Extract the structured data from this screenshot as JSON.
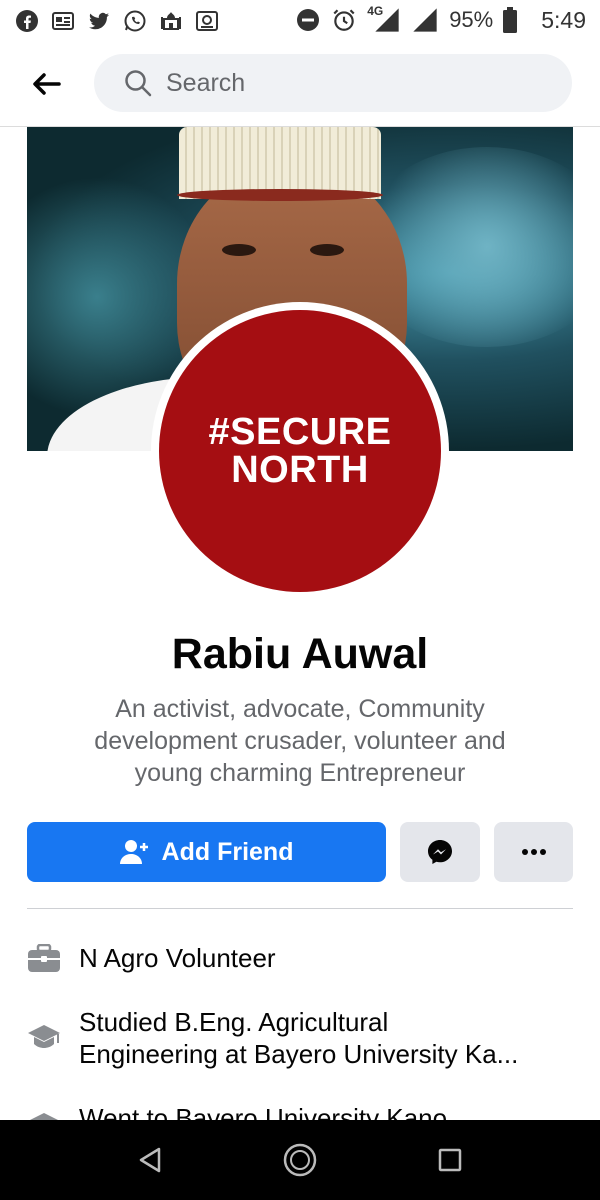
{
  "status_bar": {
    "network": "4G",
    "battery": "95%",
    "time": "5:49"
  },
  "search": {
    "placeholder": "Search"
  },
  "profile_picture": {
    "line1": "#SECURE",
    "line2": "NORTH"
  },
  "profile": {
    "name": "Rabiu Auwal",
    "bio": "An activist, advocate, Community development crusader, volunteer and young charming Entrepreneur"
  },
  "actions": {
    "add_friend_label": "Add Friend",
    "more_label": "•••"
  },
  "details": [
    {
      "icon": "briefcase-icon",
      "text": "N Agro Volunteer"
    },
    {
      "icon": "graduation-cap-icon",
      "text_line1": "Studied B.Eng. Agricultural",
      "text_line2": "Engineering at Bayero University Ka..."
    },
    {
      "icon": "graduation-cap-icon",
      "text": "Went to Bayero University Kano"
    }
  ],
  "colors": {
    "brand_blue": "#1877f2",
    "profile_red": "#a50e12",
    "secondary_text": "#65676b"
  }
}
